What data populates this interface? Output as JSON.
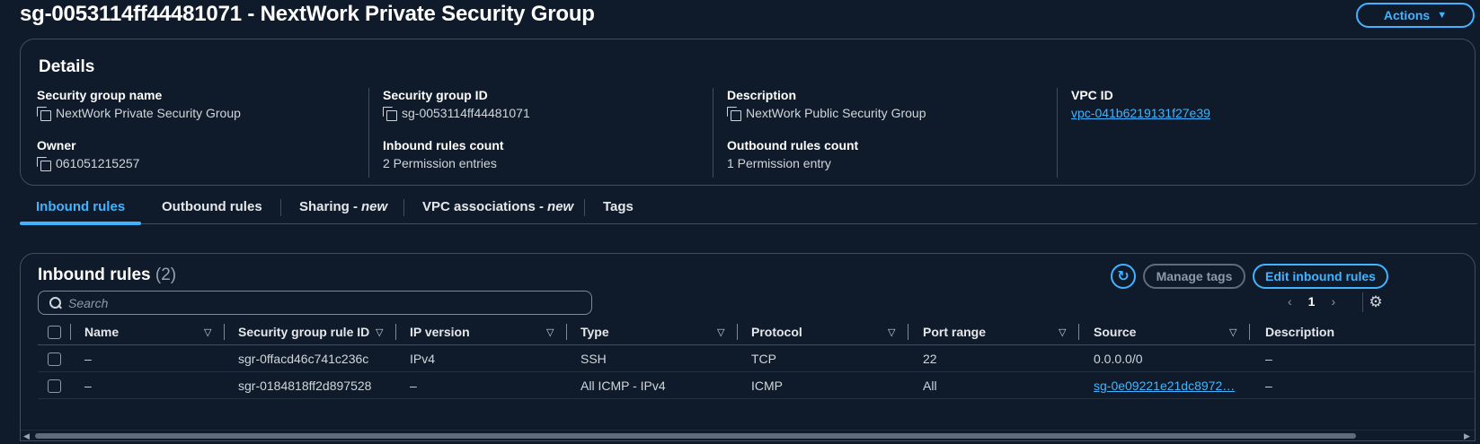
{
  "page": {
    "title": "sg-0053114ff44481071 - NextWork Private Security Group",
    "actions_label": "Actions"
  },
  "details": {
    "title": "Details",
    "fields": {
      "sg_name": {
        "label": "Security group name",
        "value": "NextWork Private Security Group"
      },
      "sg_id": {
        "label": "Security group ID",
        "value": "sg-0053114ff44481071"
      },
      "description": {
        "label": "Description",
        "value": "NextWork Public Security Group"
      },
      "vpc_id": {
        "label": "VPC ID",
        "value": "vpc-041b6219131f27e39"
      },
      "owner": {
        "label": "Owner",
        "value": "061051215257"
      },
      "inbound_count": {
        "label": "Inbound rules count",
        "value": "2 Permission entries"
      },
      "outbound_count": {
        "label": "Outbound rules count",
        "value": "1 Permission entry"
      }
    }
  },
  "tabs": {
    "inbound": "Inbound rules",
    "outbound": "Outbound rules",
    "sharing": "Sharing -",
    "sharing_new": "new",
    "vpc_assoc": "VPC associations -",
    "vpc_assoc_new": "new",
    "tags": "Tags"
  },
  "rules": {
    "title": "Inbound rules",
    "count": "(2)",
    "manage_tags_label": "Manage tags",
    "edit_label": "Edit inbound rules",
    "search_placeholder": "Search",
    "page_number": "1",
    "columns": {
      "name": "Name",
      "rule_id": "Security group rule ID",
      "ip_version": "IP version",
      "type": "Type",
      "protocol": "Protocol",
      "port_range": "Port range",
      "source": "Source",
      "description": "Description"
    },
    "rows": [
      {
        "name": "–",
        "rule_id": "sgr-0ffacd46c741c236c",
        "ip_version": "IPv4",
        "type": "SSH",
        "protocol": "TCP",
        "port_range": "22",
        "source": "0.0.0.0/0",
        "description": "–"
      },
      {
        "name": "–",
        "rule_id": "sgr-0184818ff2d897528",
        "ip_version": "–",
        "type": "All ICMP - IPv4",
        "protocol": "ICMP",
        "port_range": "All",
        "source": "sg-0e09221e21dc8972…",
        "description": "–"
      }
    ]
  },
  "icons": {
    "copy": "copy-icon",
    "search": "search-icon",
    "refresh": "refresh-icon",
    "settings": "gear-icon",
    "sort": "sort-down-icon"
  },
  "colors": {
    "background": "#0f1b2a",
    "accent": "#42b4ff",
    "border": "#414d5c"
  }
}
